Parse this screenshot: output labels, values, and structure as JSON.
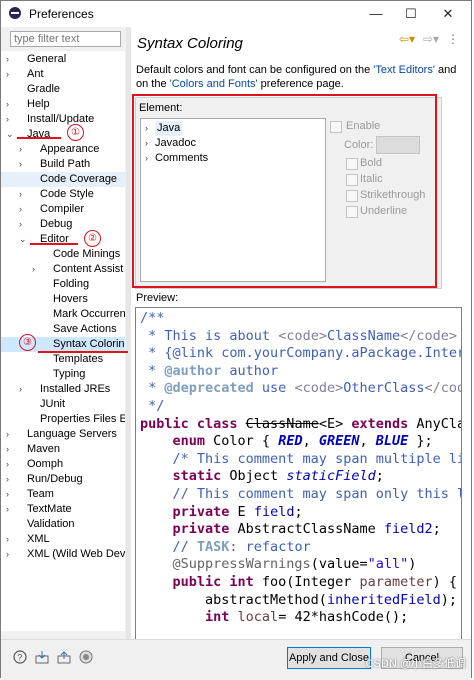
{
  "window": {
    "title": "Preferences",
    "controls": [
      "—",
      "☐",
      "✕"
    ]
  },
  "filter": {
    "placeholder": "type filter text"
  },
  "tree": [
    {
      "label": "General",
      "tw": ">"
    },
    {
      "label": "Ant",
      "tw": ">"
    },
    {
      "label": "Gradle",
      "tw": ""
    },
    {
      "label": "Help",
      "tw": ">"
    },
    {
      "label": "Install/Update",
      "tw": ">"
    },
    {
      "label": "Java",
      "tw": "v"
    },
    {
      "label": "Appearance",
      "tw": ">"
    },
    {
      "label": "Build Path",
      "tw": ">"
    },
    {
      "label": "Code Coverage",
      "tw": ""
    },
    {
      "label": "Code Style",
      "tw": ">"
    },
    {
      "label": "Compiler",
      "tw": ">"
    },
    {
      "label": "Debug",
      "tw": ">"
    },
    {
      "label": "Editor",
      "tw": "v"
    },
    {
      "label": "Code Minings",
      "tw": ""
    },
    {
      "label": "Content Assist",
      "tw": ">"
    },
    {
      "label": "Folding",
      "tw": ""
    },
    {
      "label": "Hovers",
      "tw": ""
    },
    {
      "label": "Mark Occurrences",
      "tw": ""
    },
    {
      "label": "Save Actions",
      "tw": ""
    },
    {
      "label": "Syntax Coloring",
      "tw": ""
    },
    {
      "label": "Templates",
      "tw": ""
    },
    {
      "label": "Typing",
      "tw": ""
    },
    {
      "label": "Installed JREs",
      "tw": ">"
    },
    {
      "label": "JUnit",
      "tw": ""
    },
    {
      "label": "Properties Files Editor",
      "tw": ""
    },
    {
      "label": "Language Servers",
      "tw": ">"
    },
    {
      "label": "Maven",
      "tw": ">"
    },
    {
      "label": "Oomph",
      "tw": ">"
    },
    {
      "label": "Run/Debug",
      "tw": ">"
    },
    {
      "label": "Team",
      "tw": ">"
    },
    {
      "label": "TextMate",
      "tw": ">"
    },
    {
      "label": "Validation",
      "tw": ""
    },
    {
      "label": "XML",
      "tw": ">"
    },
    {
      "label": "XML (Wild Web Developer)",
      "tw": ">"
    }
  ],
  "page": {
    "title": "Syntax Coloring",
    "desc_1": "Default colors and font can be configured on the ",
    "link_1": "'Text Editors'",
    "desc_2": " and",
    "desc_3": "on the ",
    "link_2": "'Colors and Fonts'",
    "desc_4": " preference page.",
    "element_label": "Element:",
    "elements": [
      {
        "label": "Java",
        "tw": ">"
      },
      {
        "label": "Javadoc",
        "tw": ">"
      },
      {
        "label": "Comments",
        "tw": ">"
      }
    ],
    "enable_label": "Enable",
    "color_label": "Color:",
    "bold_label": "Bold",
    "italic_label": "Italic",
    "strike_label": "Strikethrough",
    "underline_label": "Underline",
    "preview_label": "Preview:"
  },
  "code": {
    "l1": "/**",
    "l2a": " * ",
    "l2b": "This is about ",
    "l2c": "<code>",
    "l2d": "ClassName",
    "l2e": "</code>",
    "l3a": " * ",
    "l3b": "{@link com.yourCompany.aPackage.Interface}",
    "l4a": " * ",
    "l4b": "@author",
    "l4c": " author",
    "l5a": " * ",
    "l5b": "@deprecated",
    "l5c": " use ",
    "l5d": "<code>",
    "l5e": "OtherClass",
    "l5f": "</code>",
    "l6": " */",
    "l7a": "public class ",
    "l7b": "ClassName",
    "l7c": "<E> ",
    "l7d": "extends ",
    "l7e": "AnyClass",
    "l8a": "    enum ",
    "l8b": "Color { ",
    "l8c": "RED",
    "l8d": ", ",
    "l8e": "GREEN",
    "l8f": ", ",
    "l8g": "BLUE",
    "l8h": " };",
    "l9": "    /* This comment may span multiple lines. */",
    "l10a": "    static ",
    "l10b": "Object ",
    "l10c": "staticField",
    "l10d": ";",
    "l11": "    // This comment may span only this line",
    "l12a": "    private ",
    "l12b": "E ",
    "l12c": "field",
    "l12d": ";",
    "l13a": "    private ",
    "l13b": "AbstractClassName ",
    "l13c": "field2",
    "l13d": ";",
    "l14a": "    // ",
    "l14b": "TASK",
    "l14c": ": refactor",
    "l15a": "    @SuppressWarnings",
    "l15b": "(value=",
    "l15c": "\"all\"",
    "l15d": ")",
    "l16a": "    public int ",
    "l16b": "foo(Integer ",
    "l16c": "parameter",
    "l16d": ") {",
    "l17a": "        abstractMethod(",
    "l17b": "inheritedField",
    "l17c": ");",
    "l18a": "        int ",
    "l18b": "local",
    "l18c": "= 42*hashCode();"
  },
  "buttons": {
    "apply_close": "Apply and Close",
    "cancel": "Cancel"
  },
  "annotations": {
    "c1": "①",
    "c2": "②",
    "c3": "③"
  },
  "watermark": "CSDN @小白多低调"
}
